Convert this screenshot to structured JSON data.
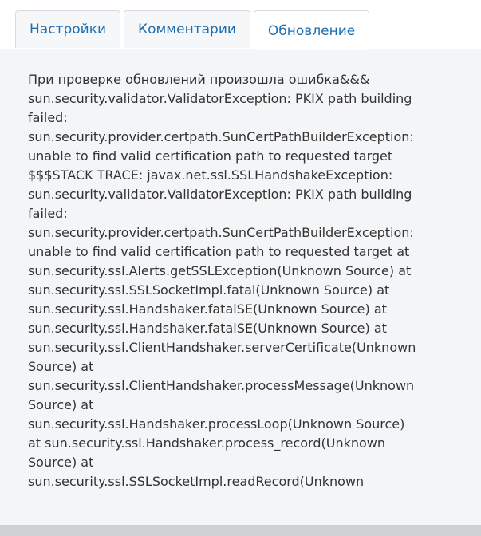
{
  "tabs": [
    {
      "label": "Настройки",
      "active": false
    },
    {
      "label": "Комментарии",
      "active": false
    },
    {
      "label": "Обновление",
      "active": true
    }
  ],
  "update_panel": {
    "error_lines": [
      "При проверке обновлений произошла ошибка&&&",
      "sun.security.validator.ValidatorException: PKIX path building",
      "failed:",
      "sun.security.provider.certpath.SunCertPathBuilderException:",
      "unable to find valid certification path to requested target",
      "$$$STACK TRACE: javax.net.ssl.SSLHandshakeException:",
      "sun.security.validator.ValidatorException: PKIX path building",
      "failed:",
      "sun.security.provider.certpath.SunCertPathBuilderException:",
      "unable to find valid certification path to requested target at",
      "sun.security.ssl.Alerts.getSSLException(Unknown Source) at",
      "sun.security.ssl.SSLSocketImpl.fatal(Unknown Source) at",
      "sun.security.ssl.Handshaker.fatalSE(Unknown Source) at",
      "sun.security.ssl.Handshaker.fatalSE(Unknown Source) at",
      "sun.security.ssl.ClientHandshaker.serverCertificate(Unknown",
      "Source) at",
      "sun.security.ssl.ClientHandshaker.processMessage(Unknown",
      "Source) at",
      "sun.security.ssl.Handshaker.processLoop(Unknown Source)",
      "at sun.security.ssl.Handshaker.process_record(Unknown",
      "Source) at",
      "sun.security.ssl.SSLSocketImpl.readRecord(Unknown"
    ]
  },
  "colors": {
    "tab_text": "#1f6fb0",
    "panel_background": "#f4f5f7",
    "body_text": "#333333",
    "border": "#d6dbe1"
  }
}
